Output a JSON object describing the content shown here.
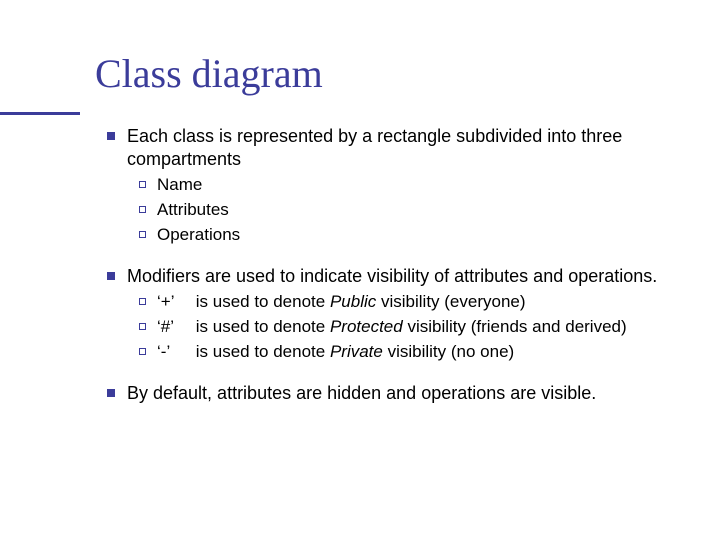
{
  "title": "Class diagram",
  "b1": {
    "text": "Each class is represented by a rectangle subdivided into three compartments",
    "sub": [
      "Name",
      "Attributes",
      "Operations"
    ]
  },
  "b2": {
    "text": "Modifiers are used to indicate visibility of attributes and operations.",
    "mods": [
      {
        "sym": "‘+’",
        "pre": "is used to denote ",
        "kind": "Public ",
        "post": "visibility (everyone)"
      },
      {
        "sym": "‘#’",
        "pre": "is used to denote ",
        "kind": "Protected ",
        "post": "visibility (friends and derived)"
      },
      {
        "sym": "‘-’",
        "pre": "is used to denote ",
        "kind": "Private ",
        "post": "visibility (no one)"
      }
    ]
  },
  "b3": {
    "text": "By default, attributes are hidden and operations are visible."
  }
}
